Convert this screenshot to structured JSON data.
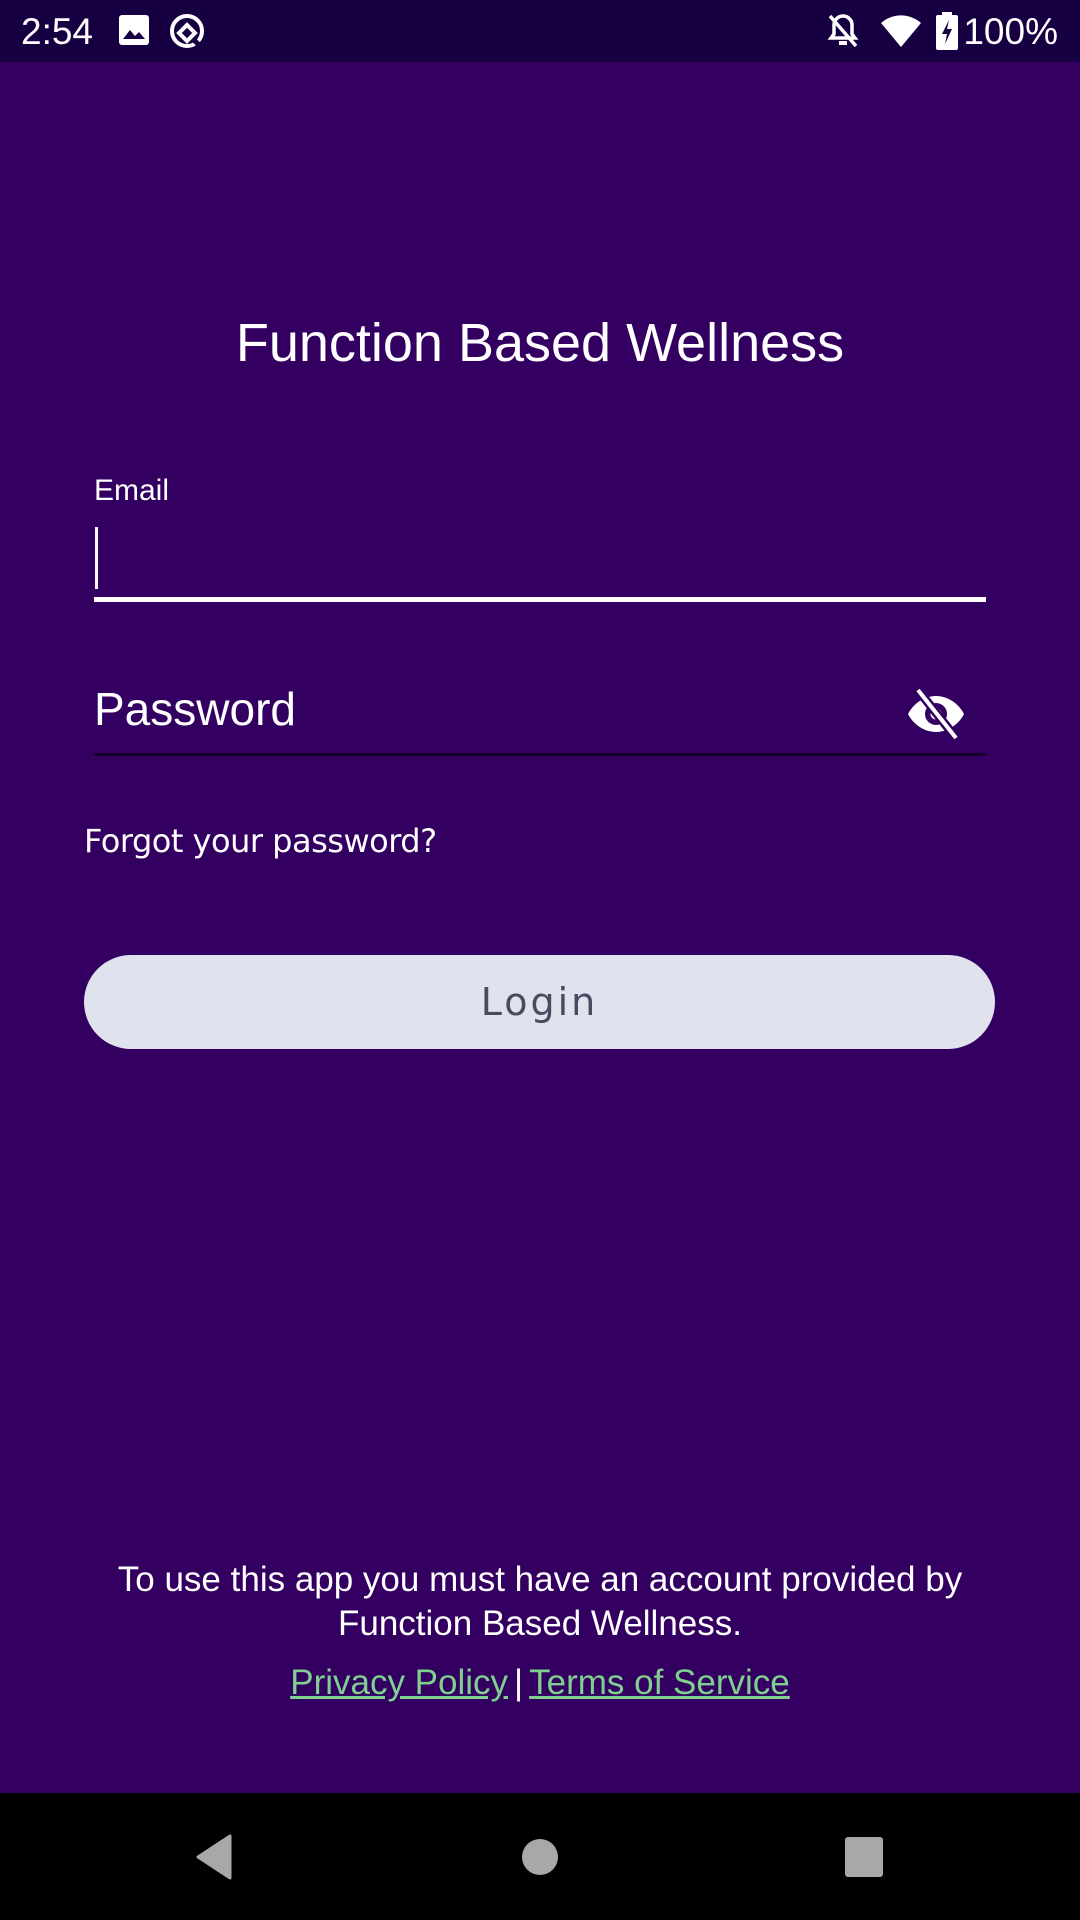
{
  "status_bar": {
    "time": "2:54",
    "left_icons": [
      "image-icon",
      "vpn-key-ring-icon"
    ],
    "right_icons": [
      "notifications-off-icon",
      "wifi-icon",
      "battery-charging-icon"
    ],
    "battery_percent": "100%"
  },
  "app": {
    "title": "Function Based Wellness",
    "background_color": "#330062"
  },
  "form": {
    "email_label": "Email",
    "email_value": "",
    "email_placeholder": "",
    "password_placeholder": "Password",
    "password_value": "",
    "password_visibility_icon": "visibility-off-icon",
    "forgot_password_label": "Forgot your password?",
    "login_label": "Login"
  },
  "footer": {
    "notice": "To use this app you must have an account provided by Function Based Wellness.",
    "privacy_label": "Privacy Policy",
    "separator": "|",
    "terms_label": "Terms of Service",
    "link_color": "#7fcf8f"
  },
  "nav_bar": {
    "buttons": [
      "back",
      "home",
      "recents"
    ]
  }
}
